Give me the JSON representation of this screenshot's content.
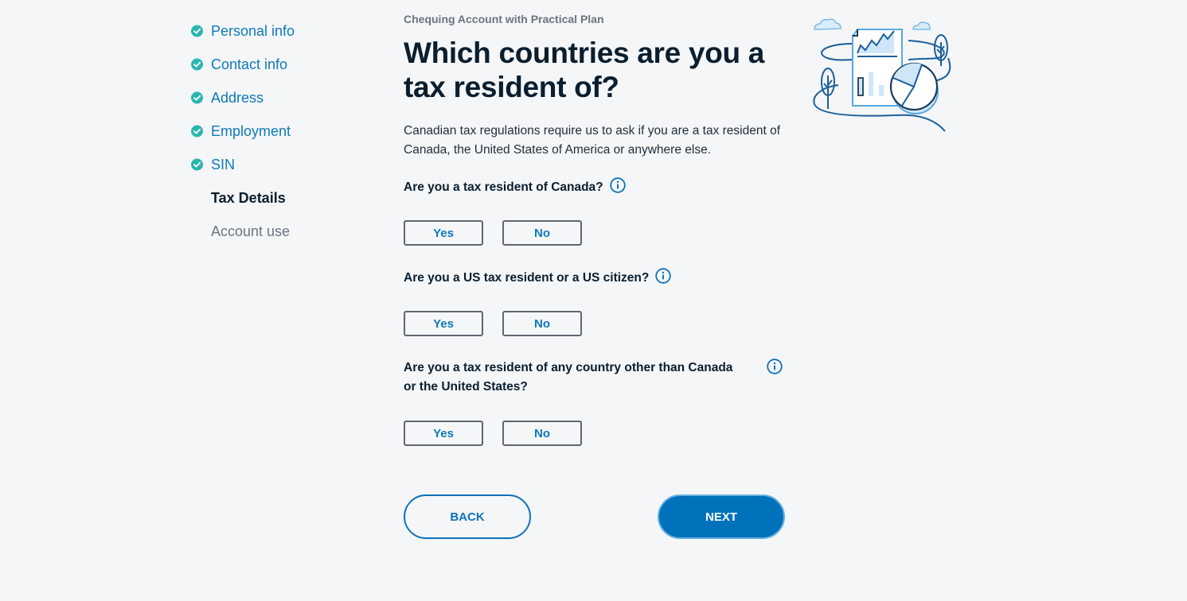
{
  "sidebar": {
    "steps": [
      {
        "label": "Personal info",
        "status": "done"
      },
      {
        "label": "Contact info",
        "status": "done"
      },
      {
        "label": "Address",
        "status": "done"
      },
      {
        "label": "Employment",
        "status": "done"
      },
      {
        "label": "SIN",
        "status": "done"
      },
      {
        "label": "Tax Details",
        "status": "current"
      },
      {
        "label": "Account use",
        "status": "todo"
      }
    ]
  },
  "header": {
    "eyebrow": "Chequing Account with Practical Plan",
    "title": "Which countries are you a tax resident of?",
    "description": "Canadian tax regulations require us to ask if you are a tax resident of Canada, the United States of America or anywhere else."
  },
  "questions": [
    {
      "label": "Are you a tax resident of Canada?",
      "yes": "Yes",
      "no": "No"
    },
    {
      "label": "Are you a US tax resident or a US citizen?",
      "yes": "Yes",
      "no": "No"
    },
    {
      "label": "Are you a tax resident of any country other than Canada or the United States?",
      "yes": "Yes",
      "no": "No"
    }
  ],
  "actions": {
    "back": "BACK",
    "next": "NEXT"
  },
  "colors": {
    "primary": "#0072bc",
    "link": "#0f7ab8",
    "check": "#2bb5b0",
    "background": "#f4f6f8"
  },
  "illustration": {
    "icon": "tax-document-chart-illustration"
  }
}
